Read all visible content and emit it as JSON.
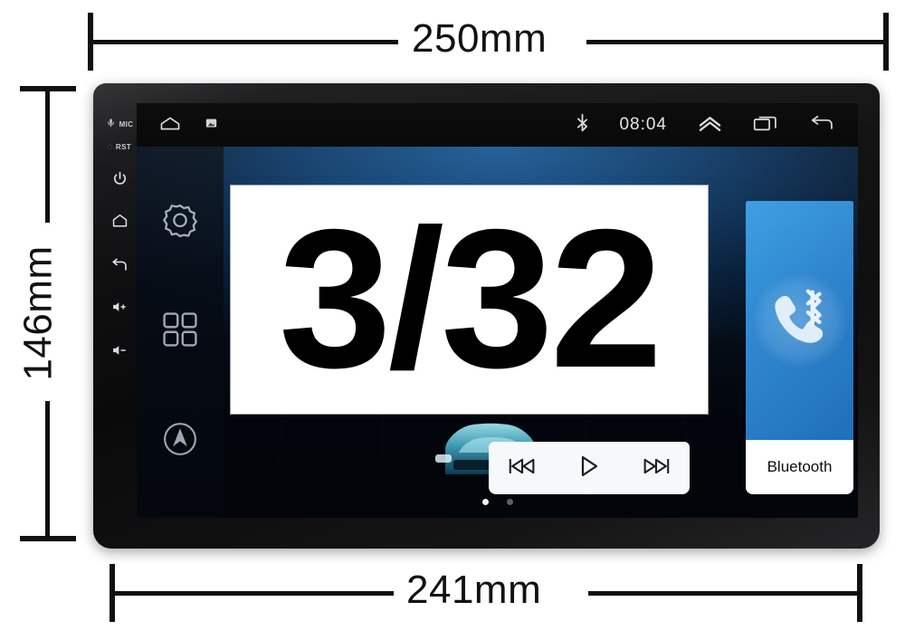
{
  "diagram": {
    "title": "Car stereo head unit dimension diagram",
    "dimensions": {
      "top_width": "250mm",
      "bottom_width": "241mm",
      "height": "146mm"
    }
  },
  "overlay": {
    "badge_text": "3/32"
  },
  "unit": {
    "hardware_buttons": [
      {
        "name": "mic",
        "label": "MIC",
        "icon": "microphone-icon"
      },
      {
        "name": "reset",
        "label": "RST",
        "icon": "pinhole-icon"
      },
      {
        "name": "power",
        "label": "",
        "icon": "power-icon"
      },
      {
        "name": "home",
        "label": "",
        "icon": "home-icon"
      },
      {
        "name": "back",
        "label": "",
        "icon": "back-arrow-icon"
      },
      {
        "name": "volume-up",
        "label": "",
        "icon": "volume-up-icon"
      },
      {
        "name": "volume-down",
        "label": "",
        "icon": "volume-down-icon"
      }
    ]
  },
  "screen": {
    "statusbar": {
      "home_icon": "home-icon",
      "notification_icon": "screenshot-icon",
      "bluetooth_icon": "bluetooth-icon",
      "clock": "08:04",
      "expand_icon": "chevron-up-icon",
      "recents_icon": "recent-apps-icon",
      "back_icon": "back-arrow-icon"
    },
    "dock": [
      {
        "name": "settings",
        "icon": "gear-icon"
      },
      {
        "name": "apps",
        "icon": "apps-grid-icon"
      },
      {
        "name": "navigation",
        "icon": "navigation-compass-icon"
      }
    ],
    "media_controls": [
      {
        "name": "previous",
        "icon": "previous-track-icon"
      },
      {
        "name": "play",
        "icon": "play-icon"
      },
      {
        "name": "next",
        "icon": "next-track-icon"
      }
    ],
    "page_indicator": {
      "total": 2,
      "active": 1
    },
    "bluetooth_card": {
      "label": "Bluetooth",
      "icon": "bluetooth-phone-icon",
      "tile_color": "#2f86cf"
    },
    "wallpaper": {
      "description": "blue gradient with car on road",
      "art_icon": "car-front-icon"
    }
  },
  "colors": {
    "bezel": "#0a0a0b",
    "accent_blue": "#2f86cf",
    "wallpaper_blue": "#123f6c",
    "dimension_line": "#111111",
    "overlay_bg": "#ffffff",
    "overlay_fg": "#000000"
  }
}
